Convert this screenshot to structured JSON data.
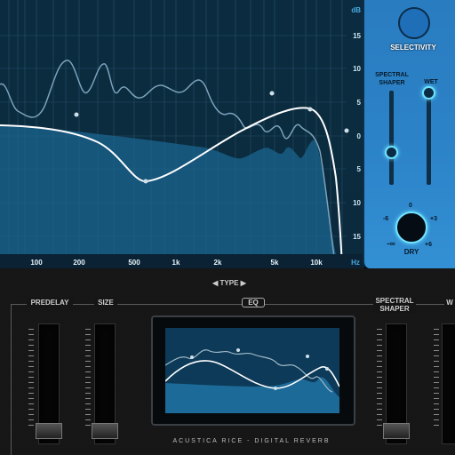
{
  "eq_display": {
    "db_unit": "dB",
    "db_scale": [
      "15",
      "10",
      "5",
      "0",
      "5",
      "10",
      "15"
    ],
    "hz_unit": "Hz",
    "hz_scale": [
      "100",
      "200",
      "500",
      "1k",
      "2k",
      "5k",
      "10k"
    ]
  },
  "side_panel": {
    "selectivity_label": "SELECTIVITY",
    "spectral_shaper_label": "SPECTRAL\nSHAPER",
    "wet_label": "WET",
    "dry_label": "DRY",
    "dry_knob": {
      "min_label": "-∞",
      "left_label": "-6",
      "top_label": "0",
      "right_label": "+3",
      "max_label": "+6"
    },
    "accent_color": "#6fe3ff",
    "panel_color": "#2c83c8"
  },
  "type_selector": {
    "left_arrow": "◀",
    "label": "TYPE",
    "right_arrow": "▶"
  },
  "lower_panel": {
    "predelay_label": "PREDELAY",
    "size_label": "SIZE",
    "eq_tab_label": "EQ",
    "spectral_shaper_label": "SPECTRAL\nSHAPER",
    "cut_label": "W",
    "product_name": "ACUSTICA RICE - DIGITAL REVERB"
  }
}
